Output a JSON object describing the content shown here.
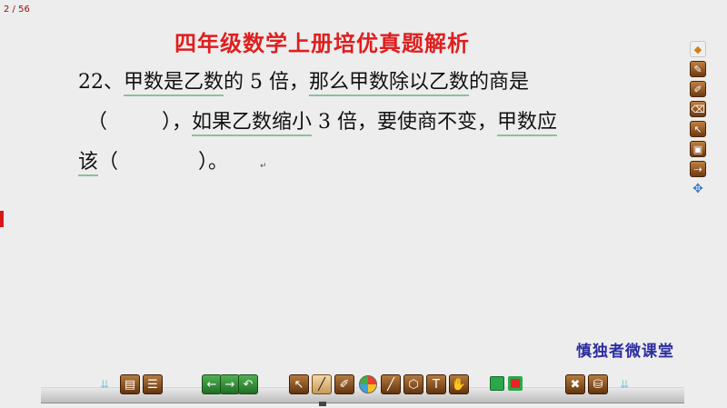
{
  "page_counter": "2 / 56",
  "title": "四年级数学上册培优真题解析",
  "question": {
    "line1": {
      "num": "22、",
      "u1": "甲数是乙数",
      "t1": "的 5 倍，",
      "u2": "那么甲数除以乙数",
      "t2": "的商是"
    },
    "line2": {
      "open": "（",
      "close": "），",
      "u1": "如果乙数缩小",
      "t1": " 3 倍，要使商不变，",
      "u2": "甲数应"
    },
    "line3": {
      "u1": "该",
      "open": "（",
      "close": "）。"
    }
  },
  "cursor_mark": "↵",
  "brand": "慎独者微课堂",
  "side_toolbar": [
    "windows-logo",
    "pen",
    "pen-settings",
    "eraser",
    "pointer",
    "screen-capture",
    "laser",
    "move"
  ],
  "side_glyphs": [
    "◆",
    "✎",
    "✐",
    "⌫",
    "↖",
    "▣",
    "⇢",
    "✥"
  ],
  "dock": {
    "left_arrow": "⇊",
    "right_arrow": "⇊",
    "buttons": [
      "▤",
      "☰",
      "←",
      "→",
      "↶",
      "↖",
      "╱",
      "✐",
      "╱",
      "⬡",
      "T",
      "✋",
      "✖",
      "⛁"
    ]
  },
  "colors": {
    "title": "#e01e1e",
    "brand": "#2b2ea0",
    "underline": "#8fbf9a",
    "tool_brown": "#7a4318"
  }
}
